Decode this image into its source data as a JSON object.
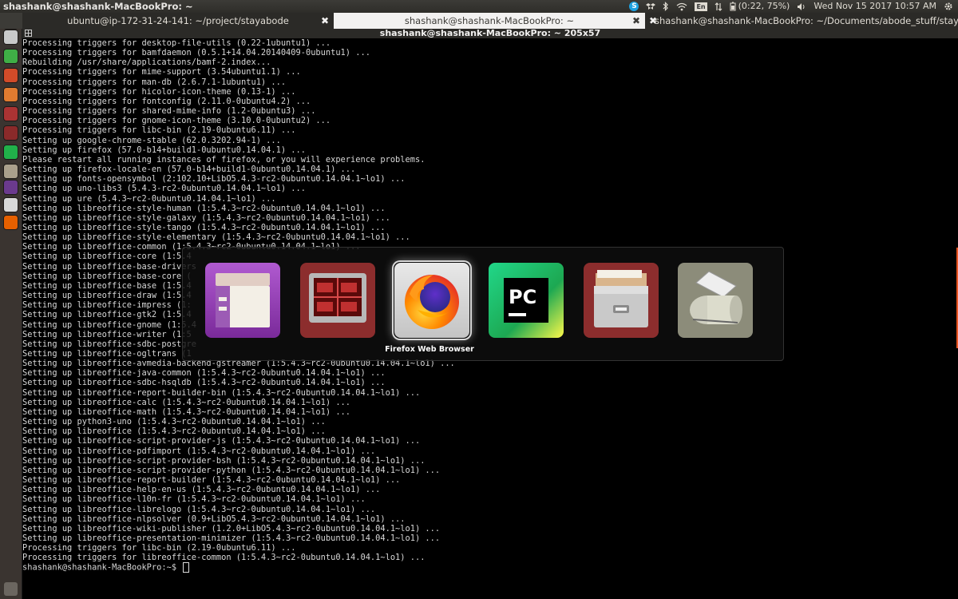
{
  "top_panel": {
    "title": "shashank@shashank-MacBookPro: ~",
    "indicators": {
      "skype_icon": "skype-icon",
      "keyboard_label": "En",
      "battery_text": "(0:22, 75%)",
      "datetime": "Wed Nov 15 2017 10:57 AM"
    }
  },
  "tabs": [
    {
      "label": "ubuntu@ip-172-31-24-141: ~/project/stayabode"
    },
    {
      "label": "shashank@shashank-MacBookPro: ~"
    },
    {
      "label": "shashank@shashank-MacBookPro: ~/Documents/abode_stuff/stayabode"
    }
  ],
  "window_title": "shashank@shashank-MacBookPro: ~ 205x57",
  "launcher": [
    {
      "name": "dash-home-icon",
      "color": "#e95420"
    },
    {
      "name": "files-icon",
      "color": "#c9c9c9"
    },
    {
      "name": "libreoffice-calc-icon",
      "color": "#3faf46"
    },
    {
      "name": "libreoffice-impress-icon",
      "color": "#d14b29"
    },
    {
      "name": "software-center-icon",
      "color": "#e07b30"
    },
    {
      "name": "settings-icon",
      "color": "#a33"
    },
    {
      "name": "system-monitor-icon",
      "color": "#8a2a2a"
    },
    {
      "name": "pycharm-icon",
      "color": "#21b14a"
    },
    {
      "name": "archive-icon",
      "color": "#aaa08c"
    },
    {
      "name": "code-editor-icon",
      "color": "#6b3a8e"
    },
    {
      "name": "document-viewer-icon",
      "color": "#d8d8d8"
    },
    {
      "name": "firefox-icon",
      "color": "#e66000"
    }
  ],
  "terminal": {
    "lines": [
      "Processing triggers for desktop-file-utils (0.22-1ubuntu1) ...",
      "Processing triggers for bamfdaemon (0.5.1+14.04.20140409-0ubuntu1) ...",
      "Rebuilding /usr/share/applications/bamf-2.index...",
      "Processing triggers for mime-support (3.54ubuntu1.1) ...",
      "Processing triggers for man-db (2.6.7.1-1ubuntu1) ...",
      "Processing triggers for hicolor-icon-theme (0.13-1) ...",
      "Processing triggers for fontconfig (2.11.0-0ubuntu4.2) ...",
      "Processing triggers for shared-mime-info (1.2-0ubuntu3) ...",
      "Processing triggers for gnome-icon-theme (3.10.0-0ubuntu2) ...",
      "Processing triggers for libc-bin (2.19-0ubuntu6.11) ...",
      "Setting up google-chrome-stable (62.0.3202.94-1) ...",
      "Setting up firefox (57.0-b14+build1-0ubuntu0.14.04.1) ...",
      "Please restart all running instances of firefox, or you will experience problems.",
      "Setting up firefox-locale-en (57.0-b14+build1-0ubuntu0.14.04.1) ...",
      "Setting up fonts-opensymbol (2:102.10+LibO5.4.3-rc2-0ubuntu0.14.04.1~lo1) ...",
      "Setting up uno-libs3 (5.4.3-rc2-0ubuntu0.14.04.1~lo1) ...",
      "Setting up ure (5.4.3~rc2-0ubuntu0.14.04.1~lo1) ...",
      "Setting up libreoffice-style-human (1:5.4.3~rc2-0ubuntu0.14.04.1~lo1) ...",
      "Setting up libreoffice-style-galaxy (1:5.4.3~rc2-0ubuntu0.14.04.1~lo1) ...",
      "Setting up libreoffice-style-tango (1:5.4.3~rc2-0ubuntu0.14.04.1~lo1) ...",
      "Setting up libreoffice-style-elementary (1:5.4.3~rc2-0ubuntu0.14.04.1~lo1) ...",
      "Setting up libreoffice-common (1:5.4.3~rc2-0ubuntu0.14.04.1~lo1) ...",
      "Setting up libreoffice-core (1:5.4",
      "Setting up libreoffice-base-drivers",
      "Setting up libreoffice-base-core (",
      "Setting up libreoffice-base (1:5.4",
      "Setting up libreoffice-draw (1:5.4",
      "Setting up libreoffice-impress (1:",
      "Setting up libreoffice-gtk2 (1:5.4",
      "Setting up libreoffice-gnome (1:5.4",
      "Setting up libreoffice-writer (1:5",
      "Setting up libreoffice-sdbc-postgre",
      "Setting up libreoffice-ogltrans (1",
      "Setting up libreoffice-avmedia-backend-gstreamer (1:5.4.3~rc2-0ubuntu0.14.04.1~lo1) ...",
      "Setting up libreoffice-java-common (1:5.4.3~rc2-0ubuntu0.14.04.1~lo1) ...",
      "Setting up libreoffice-sdbc-hsqldb (1:5.4.3~rc2-0ubuntu0.14.04.1~lo1) ...",
      "Setting up libreoffice-report-builder-bin (1:5.4.3~rc2-0ubuntu0.14.04.1~lo1) ...",
      "Setting up libreoffice-calc (1:5.4.3~rc2-0ubuntu0.14.04.1~lo1) ...",
      "Setting up libreoffice-math (1:5.4.3~rc2-0ubuntu0.14.04.1~lo1) ...",
      "Setting up python3-uno (1:5.4.3~rc2-0ubuntu0.14.04.1~lo1) ...",
      "Setting up libreoffice (1:5.4.3~rc2-0ubuntu0.14.04.1~lo1) ...",
      "Setting up libreoffice-script-provider-js (1:5.4.3~rc2-0ubuntu0.14.04.1~lo1) ...",
      "Setting up libreoffice-pdfimport (1:5.4.3~rc2-0ubuntu0.14.04.1~lo1) ...",
      "Setting up libreoffice-script-provider-bsh (1:5.4.3~rc2-0ubuntu0.14.04.1~lo1) ...",
      "Setting up libreoffice-script-provider-python (1:5.4.3~rc2-0ubuntu0.14.04.1~lo1) ...",
      "Setting up libreoffice-report-builder (1:5.4.3~rc2-0ubuntu0.14.04.1~lo1) ...",
      "Setting up libreoffice-help-en-us (1:5.4.3~rc2-0ubuntu0.14.04.1~lo1) ...",
      "Setting up libreoffice-l10n-fr (1:5.4.3~rc2-0ubuntu0.14.04.1~lo1) ...",
      "Setting up libreoffice-librelogo (1:5.4.3~rc2-0ubuntu0.14.04.1~lo1) ...",
      "Setting up libreoffice-nlpsolver (0.9+LibO5.4.3~rc2-0ubuntu0.14.04.1~lo1) ...",
      "Setting up libreoffice-wiki-publisher (1.2.0+LibO5.4.3~rc2-0ubuntu0.14.04.1~lo1) ...",
      "Setting up libreoffice-presentation-minimizer (1:5.4.3~rc2-0ubuntu0.14.04.1~lo1) ...",
      "Processing triggers for libc-bin (2.19-0ubuntu6.11) ...",
      "Processing triggers for libreoffice-common (1:5.4.3~rc2-0ubuntu0.14.04.1~lo1) ..."
    ],
    "prompt": "shashank@shashank-MacBookPro:~$ "
  },
  "switcher": {
    "items": [
      {
        "name": "files-app",
        "icon": "files-icon"
      },
      {
        "name": "system-monitor-app",
        "icon": "system-monitor-icon"
      },
      {
        "name": "firefox-app",
        "icon": "firefox-icon",
        "selected": true
      },
      {
        "name": "pycharm-app",
        "icon": "pycharm-icon"
      },
      {
        "name": "archive-manager-app",
        "icon": "archive-icon"
      },
      {
        "name": "printer-app",
        "icon": "printer-icon"
      }
    ],
    "selected_label": "Firefox Web Browser"
  }
}
